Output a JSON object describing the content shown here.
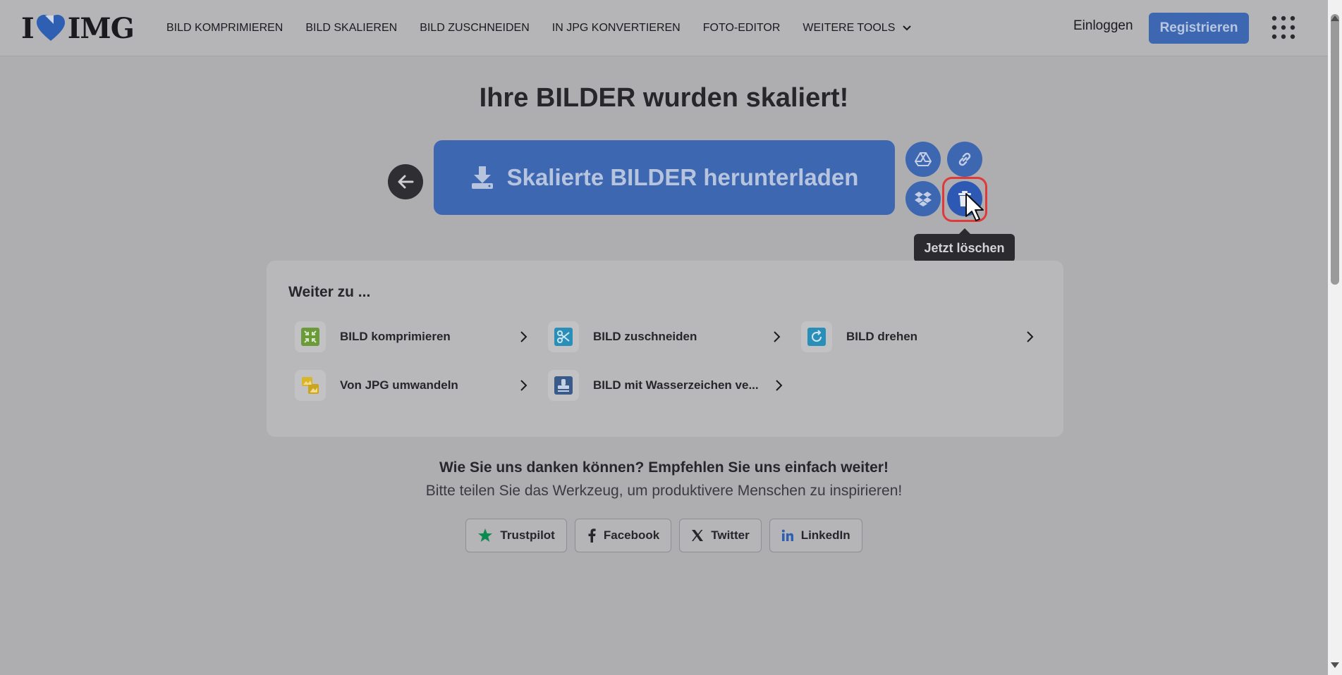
{
  "header": {
    "logo_text": "I♥IMG",
    "nav": [
      {
        "label": "BILD KOMPRIMIEREN"
      },
      {
        "label": "BILD SKALIEREN"
      },
      {
        "label": "BILD ZUSCHNEIDEN"
      },
      {
        "label": "IN JPG KONVERTIEREN"
      },
      {
        "label": "FOTO-EDITOR"
      },
      {
        "label": "WEITERE TOOLS"
      }
    ],
    "login_label": "Einloggen",
    "register_label": "Registrieren"
  },
  "main": {
    "title": "Ihre BILDER wurden skaliert!",
    "download_label": "Skalierte BILDER herunterladen",
    "delete_tooltip": "Jetzt löschen"
  },
  "continue": {
    "title": "Weiter zu ...",
    "tools": [
      {
        "label": "BILD komprimieren",
        "icon": "compress-icon",
        "color": "#6b9a3a"
      },
      {
        "label": "BILD zuschneiden",
        "icon": "scissors-icon",
        "color": "#2a8fb8"
      },
      {
        "label": "BILD drehen",
        "icon": "rotate-icon",
        "color": "#2a8fb8"
      },
      {
        "label": "Von JPG umwandeln",
        "icon": "convert-image-icon",
        "color": "#d8b52a"
      },
      {
        "label": "BILD mit Wasserzeichen ve...",
        "icon": "stamp-icon",
        "color": "#3a5a8a"
      }
    ]
  },
  "share": {
    "thanks": "Wie Sie uns danken können? Empfehlen Sie uns einfach weiter!",
    "subtitle": "Bitte teilen Sie das Werkzeug, um produktivere Menschen zu inspirieren!",
    "buttons": [
      {
        "label": "Trustpilot",
        "icon": "star-icon"
      },
      {
        "label": "Facebook",
        "icon": "facebook-icon"
      },
      {
        "label": "Twitter",
        "icon": "x-icon"
      },
      {
        "label": "LinkedIn",
        "icon": "linkedin-icon"
      }
    ]
  },
  "colors": {
    "accent": "#3e67b2",
    "highlight": "#e0393b"
  }
}
